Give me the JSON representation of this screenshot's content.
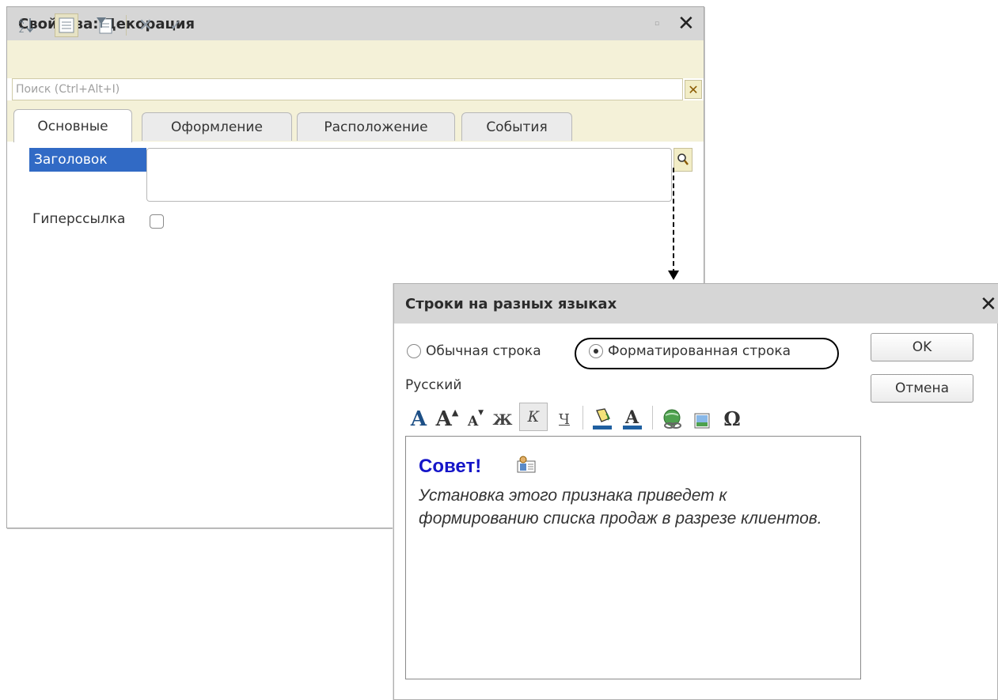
{
  "properties": {
    "title": "Свойства: Декорация",
    "search_placeholder": "Поиск (Ctrl+Alt+I)",
    "tabs": [
      {
        "label": "Основные",
        "active": true
      },
      {
        "label": "Оформление",
        "active": false
      },
      {
        "label": "Расположение",
        "active": false
      },
      {
        "label": "События",
        "active": false
      }
    ],
    "title_field_label": "Заголовок",
    "hyperlink_label": "Гиперссылка",
    "hyperlink_checked": false,
    "toolbar_icons": [
      "sort-az-icon",
      "categories-icon",
      "filter-icon",
      "delete-icon",
      "check-icon"
    ]
  },
  "dialog": {
    "title": "Строки на разных языках",
    "option_plain": "Обычная строка",
    "option_formatted": "Форматированная строка",
    "selected_option": "formatted",
    "ok_label": "OK",
    "cancel_label": "Отмена",
    "language_label": "Русский",
    "format_tools": [
      "font-icon",
      "font-increase-icon",
      "font-decrease-icon",
      "bold-icon",
      "italic-icon",
      "underline-icon",
      "background-color-icon",
      "text-color-icon",
      "hyperlink-icon",
      "picture-icon",
      "special-char-icon"
    ],
    "editor": {
      "heading": "Совет!",
      "body": "Установка этого признака приведет к формированию списка продаж в разрезе клиентов."
    }
  },
  "colors": {
    "titlebar": "#d6d6d6",
    "toolbar": "#f4f1d8",
    "selection": "#316ac5",
    "tip_heading": "#1515c8"
  }
}
